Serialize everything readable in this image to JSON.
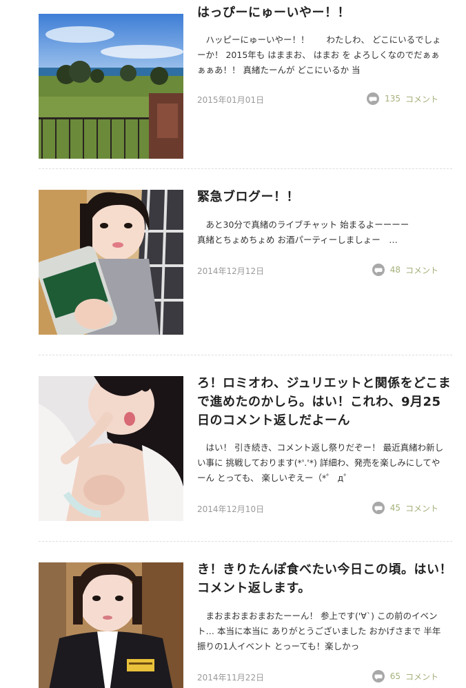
{
  "posts": [
    {
      "title": "はっぴーにゅーいやー！！",
      "excerpt": "　ハッピーにゅーいやー！！　　わたしわ、 どこにいるでしょーか！ 2015年も はままお、 はまお を よろしくなのでだぁぁぁぁあ！！ 真緒たーんが どこにいるか 当",
      "date": "2015年01月01日",
      "comment_count": "135",
      "comment_label": "コメント",
      "image": "resort-lawn-ocean-photo"
    },
    {
      "title": "緊急ブログー！！",
      "excerpt": "　あと30分で真緒のライブチャット 始まるよーーーー\n真緒とちょめちょめ お酒パーティーしましょー　…",
      "date": "2014年12月12日",
      "comment_count": "48",
      "comment_label": "コメント",
      "image": "selfie-with-beer-can-photo"
    },
    {
      "title": "ろ！ロミオわ、ジュリエットと関係をどこまで進めたのかしら。はい！これわ、9月25日のコメント返しだよーん",
      "excerpt": "　はい！ 引き続き、コメント返し祭りだぞー！ 最近真緒わ新しい事に 挑戦しております(*'.'*) 詳細わ、発売を楽しみにしてやーん とっても、 楽しいぞえー（*゜ д゜",
      "date": "2014年12月10日",
      "comment_count": "45",
      "comment_label": "コメント",
      "image": "selfie-white-robe-photo"
    },
    {
      "title": "き！きりたんぽ食べたい今日この頃。はい！コメント返します。",
      "excerpt": "　まおまおまおまおたーーん！ 参上です('∀`) この前のイベント… 本当に本当に ありがとうございました おかげさまで 半年振りの1人イベント とっーても！楽しかっ",
      "date": "2014年11月22日",
      "comment_count": "65",
      "comment_label": "コメント",
      "image": "selfie-black-uniform-photo"
    }
  ],
  "colors": {
    "title": "#222222",
    "date": "#999999",
    "comment_accent": "#a3b07a",
    "comment_icon": "#a8a8a8",
    "divider": "#dddddd"
  }
}
